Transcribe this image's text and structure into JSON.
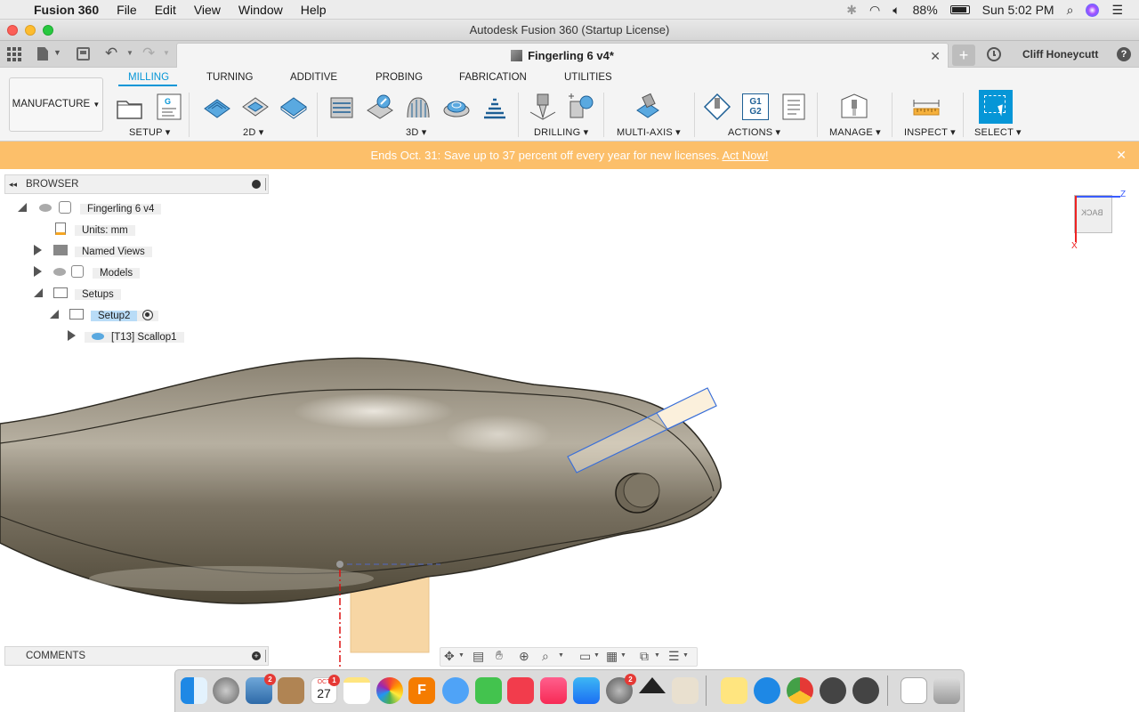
{
  "menubar": {
    "app_name": "Fusion 360",
    "items": [
      "File",
      "Edit",
      "View",
      "Window",
      "Help"
    ],
    "battery": "88%",
    "clock": "Sun 5:02 PM"
  },
  "window": {
    "title": "Autodesk Fusion 360 (Startup License)",
    "doc_tab": "Fingerling 6 v4*",
    "user": "Cliff Honeycutt"
  },
  "toolbar": {
    "workspace": "MANUFACTURE",
    "tabs": [
      "MILLING",
      "TURNING",
      "ADDITIVE",
      "PROBING",
      "FABRICATION",
      "UTILITIES"
    ],
    "active_tab": "MILLING",
    "groups": [
      "SETUP",
      "2D",
      "3D",
      "DRILLING",
      "MULTI-AXIS",
      "ACTIONS",
      "MANAGE",
      "INSPECT",
      "SELECT"
    ]
  },
  "promo": {
    "text": "Ends Oct. 31: Save up to 37 percent off every year for new licenses.",
    "link": "Act Now!"
  },
  "browser": {
    "header": "BROWSER",
    "root": "Fingerling 6 v4",
    "units": "Units: mm",
    "named_views": "Named Views",
    "models": "Models",
    "setups": "Setups",
    "setup2": "Setup2",
    "op": "[T13] Scallop1"
  },
  "comments": {
    "header": "COMMENTS"
  },
  "viewcube": {
    "face": "BACK",
    "axis_z": "Z",
    "axis_x": "X"
  },
  "actions_icon_text": "G1\nG2",
  "dock": {
    "calendar_month": "OCT",
    "calendar_day": "27",
    "badges": {
      "mail": "2",
      "calendar": "1",
      "prefs": "2"
    }
  },
  "colors": {
    "accent": "#0696d7",
    "promo": "#fcbf6a",
    "model": "#6e6656",
    "stock": "#f7d6a4"
  }
}
